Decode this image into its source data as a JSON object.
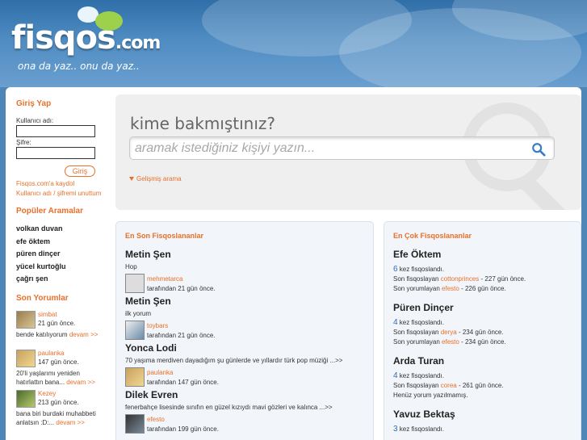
{
  "header": {
    "logo_main": "fisqos",
    "logo_tld": ".com",
    "slogan": "ona da yaz.. onu da yaz.."
  },
  "login": {
    "title": "Giriş Yap",
    "username_label": "Kullanıcı adı:",
    "password_label": "Şifre:",
    "button": "Giriş",
    "register_link": "Fisqos.com'a kaydol",
    "forgot_link": "Kullanıcı adı / şifremi unuttum"
  },
  "popular": {
    "title": "Popüler Aramalar",
    "items": [
      "volkan duvan",
      "efe öktem",
      "püren dinçer",
      "yücel kurtoğlu",
      "çağrı şen"
    ]
  },
  "recent_comments": {
    "title": "Son Yorumlar",
    "more": "devam >>",
    "items": [
      {
        "user": "simbat",
        "time": "21 gün önce.",
        "text": "bende katılıyorum"
      },
      {
        "user": "paulanka",
        "time": "147 gün önce.",
        "text": "20'li yaşlarımı yeniden hatırlattın bana..."
      },
      {
        "user": "Kezey",
        "time": "213 gün önce.",
        "text": "bana biri burdaki muhabbeti anlatsın :D:..."
      }
    ]
  },
  "search": {
    "title": "kime bakmıştınız?",
    "placeholder": "aramak istediğiniz kişiyi yazın...",
    "advanced": "Gelişmiş arama"
  },
  "latest": {
    "title": "En Son Fisqoslananlar",
    "entries": [
      {
        "name": "Metin Şen",
        "text": "Hop",
        "user": "mehmetarca",
        "time": "tarafından 21 gün önce."
      },
      {
        "name": "Metin Şen",
        "text": "ilk yorum",
        "user": "toybars",
        "time": "tarafından 21 gün önce."
      },
      {
        "name": "Yonca Lodi",
        "text": "70 yaşıma merdiven dayadığım şu günlerde ve yıllardır türk pop müziği ...>>",
        "user": "paulanka",
        "time": "tarafından 147 gün önce."
      },
      {
        "name": "Dilek Evren",
        "text": "fenerbahçe lisesinde sınıfın en güzel kızıydı mavi gözleri ve kalınca ...>>",
        "user": "efesto",
        "time": "tarafından 199 gün önce."
      }
    ]
  },
  "most": {
    "title": "En Çok Fisqoslananlar",
    "count_suffix": "kez fisqoslandı.",
    "last_fisqos_prefix": "Son fisqoslayan",
    "last_comment_prefix": "Son yorumlayan",
    "no_comment": "Henüz yorum yazılmamış.",
    "entries": [
      {
        "name": "Efe Öktem",
        "count": "6",
        "fisqos_user": "cottonprinces",
        "fisqos_time": "- 227 gün önce.",
        "comment_user": "efesto",
        "comment_time": "- 226 gün önce."
      },
      {
        "name": "Püren Dinçer",
        "count": "4",
        "fisqos_user": "derya",
        "fisqos_time": "- 234 gün önce.",
        "comment_user": "efesto",
        "comment_time": "- 234 gün önce."
      },
      {
        "name": "Arda Turan",
        "count": "4",
        "fisqos_user": "corea",
        "fisqos_time": "- 261 gün önce."
      },
      {
        "name": "Yavuz Bektaş",
        "count": "3"
      }
    ]
  },
  "colors": {
    "accent": "#e8702a",
    "link_blue": "#2e6db3",
    "header_blue": "#2f6ea8"
  }
}
